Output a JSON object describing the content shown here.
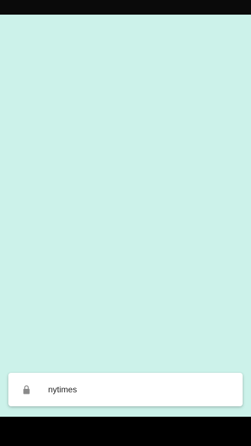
{
  "snackbar": {
    "label": "nytimes",
    "icon": "lock-icon"
  },
  "colors": {
    "background": "#ccf2ea",
    "status_bar": "#0a0a0a",
    "nav_bar": "#000000",
    "card": "#ffffff",
    "icon": "#8a8a8a",
    "text": "#1f1f1f"
  }
}
